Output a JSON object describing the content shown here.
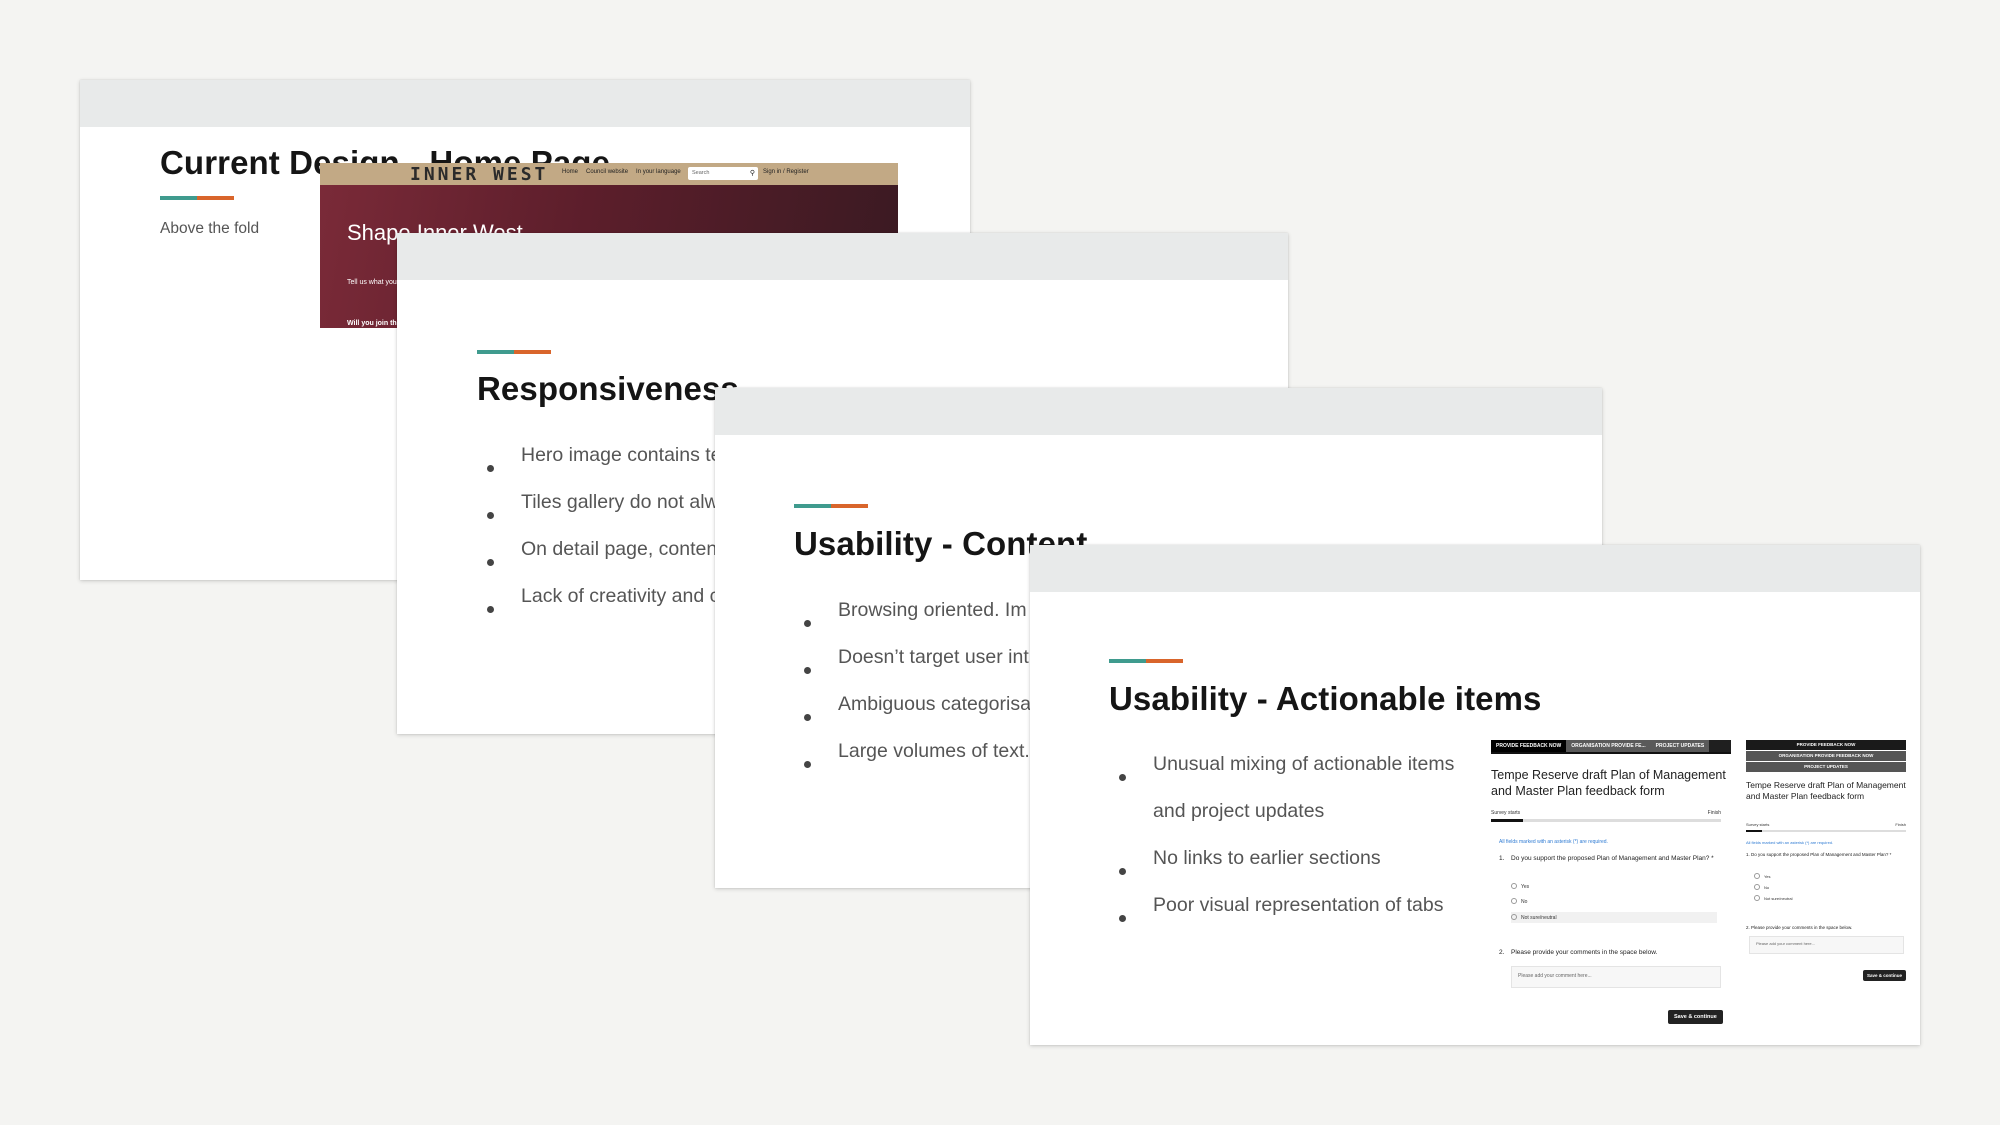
{
  "colors": {
    "background": "#f4f4f2",
    "header_band": "#e8eaea",
    "accent_teal": "#3f9b8e",
    "accent_orange": "#d9652b"
  },
  "slide1": {
    "title": "Current Design - Home Page",
    "label": "Above the fold",
    "hero": {
      "logo": "INNER WEST",
      "nav": [
        "Home",
        "Council website",
        "In your language"
      ],
      "search_placeholder": "Search",
      "search_icon": "search-icon",
      "sign_in": "Sign in / Register",
      "heading": "Shape Inner West",
      "paragraph": "Tell us what you think. Our community ... our area and ...",
      "join": "Will you join the conversation?"
    }
  },
  "slide2": {
    "title": "Responsiveness",
    "bullets": [
      "Hero image contains text",
      "Tiles gallery do not always",
      "On detail page, content",
      "Lack of creativity and consistency"
    ]
  },
  "slide3": {
    "title": "Usability - Content",
    "bullets": [
      "Browsing oriented. Im",
      "Doesn’t target user int",
      "Ambiguous categorisa",
      "Large volumes of text."
    ]
  },
  "slide4": {
    "title": "Usability - Actionable items",
    "bullets": [
      "Unusual mixing of actionable items",
      "and project updates",
      "No links to earlier sections",
      "Poor visual representation of tabs"
    ],
    "desktop_form": {
      "tabs": [
        "PROVIDE FEEDBACK NOW",
        "ORGANISATION PROVIDE FE...",
        "PROJECT UPDATES"
      ],
      "title": "Tempe Reserve draft Plan of Management and Master Plan feedback form",
      "progress_fraction": 0.14,
      "progress_start": "Survey starts",
      "progress_end": "Finish",
      "required_note": "All fields marked with an asterisk (*) are required.",
      "q1_num": "1.",
      "q1": "Do you support the proposed Plan of Management and Master Plan? *",
      "options": [
        "Yes",
        "No",
        "Not sure/neutral"
      ],
      "q2_num": "2.",
      "q2": "Please provide your comments in the space below.",
      "comment_placeholder": "Please add your comment here...",
      "save": "Save & continue"
    },
    "mobile_form": {
      "tabs": [
        "PROVIDE FEEDBACK NOW",
        "ORGANISATION PROVIDE FEEDBACK NOW",
        "PROJECT UPDATES"
      ],
      "title": "Tempe Reserve draft Plan of Management and Master Plan feedback form",
      "progress_fraction": 0.1,
      "progress_start": "Survey starts",
      "progress_end": "Finish",
      "required_note": "All fields marked with an asterisk (*) are required.",
      "q1": "1. Do you support the proposed Plan of Management and Master Plan? *",
      "options": [
        "Yes",
        "No",
        "Not sure/neutral"
      ],
      "q2": "2. Please provide your comments in the space below.",
      "comment_placeholder": "Please add your comment here...",
      "save": "Save & continue"
    }
  }
}
